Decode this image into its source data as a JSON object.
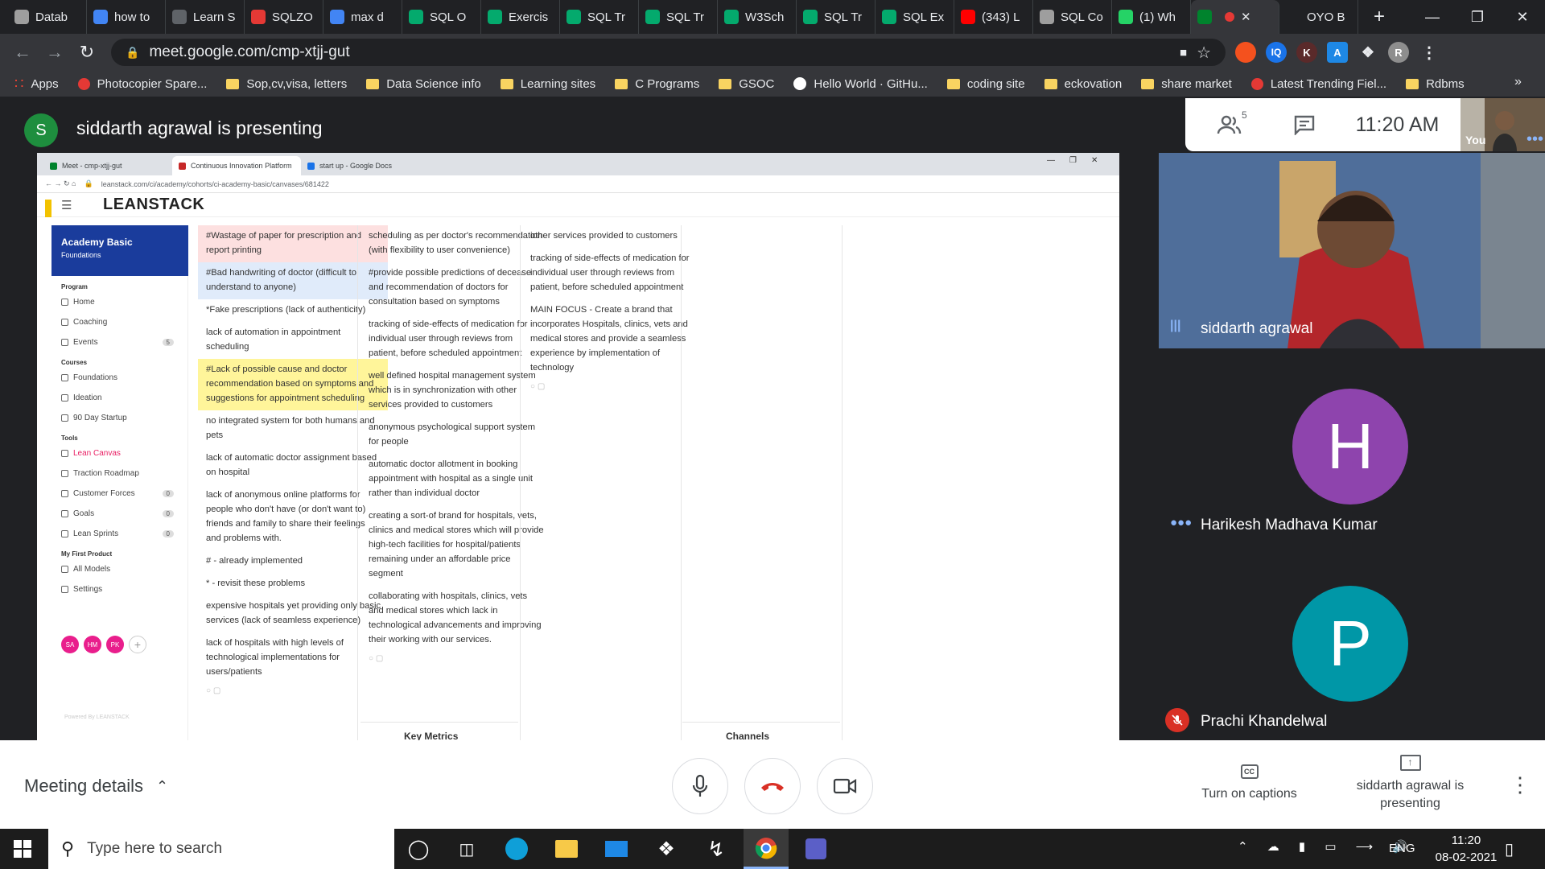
{
  "browser": {
    "tabs": [
      {
        "label": "Datab",
        "color": "#9e9e9e"
      },
      {
        "label": "how to",
        "color": "#4285f4"
      },
      {
        "label": "Learn S",
        "color": "#5f6368"
      },
      {
        "label": "SQLZO",
        "color": "#e53935"
      },
      {
        "label": "max d",
        "color": "#4285f4"
      },
      {
        "label": "SQL O",
        "color": "#04aa6d"
      },
      {
        "label": "Exercis",
        "color": "#04aa6d"
      },
      {
        "label": "SQL Tr",
        "color": "#04aa6d"
      },
      {
        "label": "SQL Tr",
        "color": "#04aa6d"
      },
      {
        "label": "W3Sch",
        "color": "#04aa6d"
      },
      {
        "label": "SQL Tr",
        "color": "#04aa6d"
      },
      {
        "label": "SQL Ex",
        "color": "#04aa6d"
      },
      {
        "label": "(343) L",
        "color": "#ff0000"
      },
      {
        "label": "SQL Co",
        "color": "#9e9e9e"
      },
      {
        "label": "(1) Wh",
        "color": "#25d366"
      },
      {
        "label": "",
        "color": "#00832d",
        "active": true
      },
      {
        "label": "OYO B",
        "color": "#202124"
      }
    ],
    "url": "meet.google.com/cmp-xtjj-gut",
    "bookmarks": [
      {
        "label": "Apps",
        "type": "apps"
      },
      {
        "label": "Photocopier Spare...",
        "type": "site"
      },
      {
        "label": "Sop,cv,visa, letters",
        "type": "folder"
      },
      {
        "label": "Data Science info",
        "type": "folder"
      },
      {
        "label": "Learning sites",
        "type": "folder"
      },
      {
        "label": "C Programs",
        "type": "folder"
      },
      {
        "label": "GSOC",
        "type": "folder"
      },
      {
        "label": "Hello World · GitHu...",
        "type": "github"
      },
      {
        "label": "coding site",
        "type": "folder"
      },
      {
        "label": "eckovation",
        "type": "folder"
      },
      {
        "label": "share market",
        "type": "folder"
      },
      {
        "label": "Latest Trending Fiel...",
        "type": "site"
      },
      {
        "label": "Rdbms",
        "type": "folder"
      }
    ],
    "profile_initial": "R",
    "ext_initial": "K"
  },
  "meet": {
    "presenter_initial": "S",
    "presenting_title": "siddarth agrawal is presenting",
    "people_count": "5",
    "time": "11:20 AM",
    "self_label": "You",
    "participants": [
      {
        "name": "siddarth agrawal",
        "initial": "S",
        "color": "#1e8e3e"
      },
      {
        "name": "Harikesh Madhava Kumar",
        "initial": "H",
        "color": "#8e44ad"
      },
      {
        "name": "Prachi Khandelwal",
        "initial": "P",
        "color": "#0097a7"
      }
    ],
    "meeting_details": "Meeting details",
    "captions_label": "Turn on captions",
    "present_label": "siddarth agrawal is presenting"
  },
  "shared": {
    "tabs": [
      "Meet - cmp-xtjj-gut",
      "Continuous Innovation Platform",
      "start up - Google Docs"
    ],
    "url": "leanstack.com/ci/academy/cohorts/ci-academy-basic/canvases/681422",
    "brand": "LEANSTACK",
    "course_title": "Academy Basic",
    "course_sub": "Foundations",
    "nav": [
      {
        "section": "Program",
        "items": [
          {
            "label": "Home",
            "count": ""
          },
          {
            "label": "Coaching",
            "count": ""
          },
          {
            "label": "Events",
            "count": "5"
          }
        ]
      },
      {
        "section": "Courses",
        "items": [
          {
            "label": "Foundations",
            "count": ""
          },
          {
            "label": "Ideation",
            "count": ""
          },
          {
            "label": "90 Day Startup",
            "count": ""
          }
        ]
      },
      {
        "section": "Tools",
        "items": [
          {
            "label": "Lean Canvas",
            "count": "",
            "active": true
          },
          {
            "label": "Traction Roadmap",
            "count": ""
          },
          {
            "label": "Customer Forces",
            "count": "0"
          },
          {
            "label": "Goals",
            "count": "0"
          },
          {
            "label": "Lean Sprints",
            "count": "0"
          }
        ]
      },
      {
        "section": "My First Product",
        "items": [
          {
            "label": "All Models",
            "count": ""
          },
          {
            "label": "Settings",
            "count": ""
          }
        ]
      }
    ],
    "avatars": [
      {
        "initials": "SA"
      },
      {
        "initials": "HM"
      },
      {
        "initials": "PK"
      }
    ],
    "powered": "Powered By LEANSTACK",
    "col1": [
      {
        "text": "#Wastage of paper for prescription and report printing",
        "style": "pink"
      },
      {
        "text": "#Bad handwriting of doctor (difficult to understand to anyone)",
        "style": "blue"
      },
      {
        "text": "*Fake prescriptions (lack of authenticity)",
        "style": ""
      },
      {
        "text": "lack of automation in appointment scheduling",
        "style": ""
      },
      {
        "text": "#Lack of possible cause and doctor recommendation based on symptoms and suggestions for appointment scheduling",
        "style": "yellow"
      },
      {
        "text": "no integrated system for both humans and pets",
        "style": ""
      },
      {
        "text": "lack of automatic doctor assignment based on hospital",
        "style": ""
      },
      {
        "text": "lack of anonymous online platforms for people who don't have (or don't want to) friends and family to share their feelings and problems with.",
        "style": ""
      },
      {
        "text": "# - already implemented",
        "style": ""
      },
      {
        "text": "* - revisit these problems",
        "style": ""
      },
      {
        "text": "expensive hospitals yet providing only basic services (lack of seamless experience)",
        "style": ""
      },
      {
        "text": "lack of hospitals with high levels of technological implementations for users/patients",
        "style": ""
      }
    ],
    "col2": [
      {
        "text": "scheduling as per doctor's recommendation (with flexibility to user convenience)"
      },
      {
        "text": "#provide possible predictions of decease and recommendation of doctors for consultation  based on symptoms"
      },
      {
        "text": "tracking of side-effects of medication for individual user through reviews from patient, before scheduled appointment"
      },
      {
        "text": "well defined hospital management system which is in synchronization with other services provided to customers"
      },
      {
        "text": "anonymous psychological support system for people"
      },
      {
        "text": "automatic doctor allotment in booking appointment with hospital as a single unit rather than individual doctor"
      },
      {
        "text": "creating a sort-of brand for hospitals, vets, clinics and medical stores which will provide high-tech facilities for hospital/patients remaining under an affordable price segment"
      },
      {
        "text": "collaborating with hospitals, clinics, vets and medical stores which lack in technological advancements and improving their working with our services."
      }
    ],
    "col3": [
      {
        "text": "other services provided to customers"
      },
      {
        "text": "tracking of side-effects of medication for individual user through reviews from patient, before scheduled appointment"
      },
      {
        "text": "MAIN FOCUS - Create a brand that incorporates Hospitals, clinics, vets and medical stores and provide a seamless experience by implementation of technology"
      }
    ],
    "key_metrics": "Key Metrics",
    "channels": "Channels"
  },
  "taskbar": {
    "search_placeholder": "Type here to search",
    "lang": "ENG",
    "time": "11:20",
    "date": "08-02-2021"
  }
}
